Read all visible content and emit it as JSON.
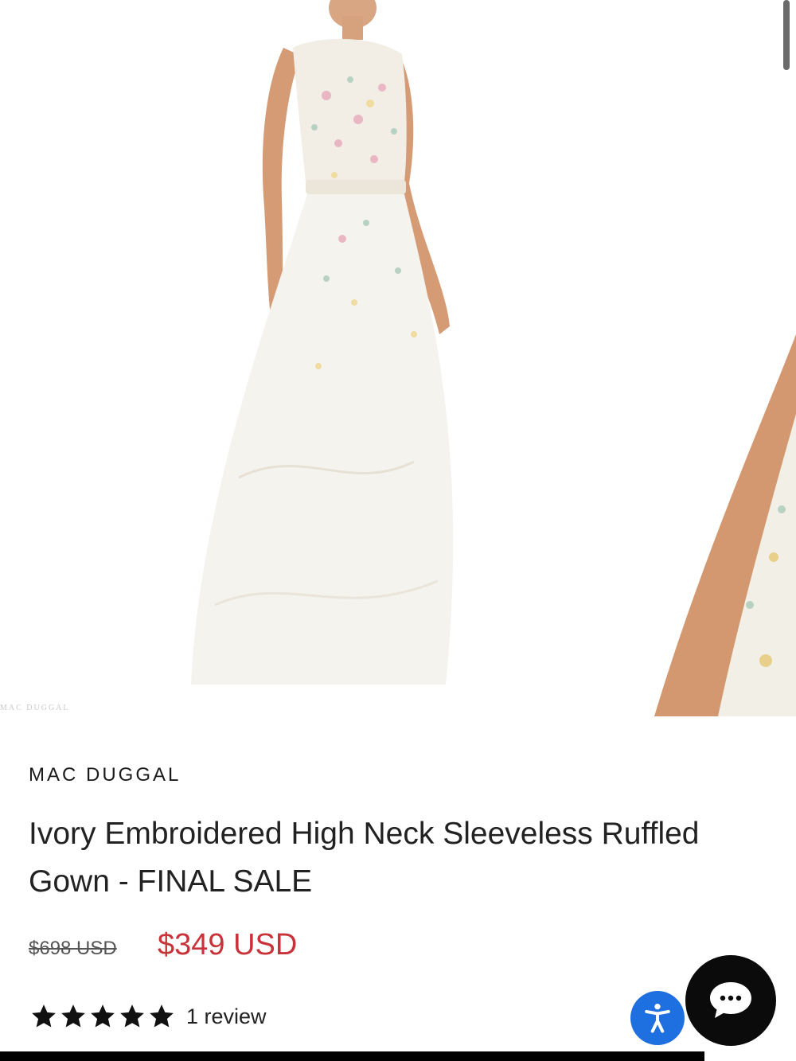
{
  "gallery": {
    "main_image": "dress-photo",
    "next_image": "dress-detail-photo",
    "watermark": "MAC DUGGAL"
  },
  "product": {
    "brand": "MAC DUGGAL",
    "title": "Ivory Embroidered High Neck Sleeveless Ruffled Gown - FINAL SALE",
    "original_price": "$698 USD",
    "sale_price": "$349 USD",
    "rating": 5,
    "review_count_label": "1 review"
  },
  "widgets": {
    "accessibility_icon": "accessibility-icon",
    "chat_icon": "chat-bubble-icon"
  },
  "colors": {
    "sale_price": "#c8333a",
    "accessibility_button": "#1e6fe0",
    "chat_button": "#0b0b0b"
  }
}
